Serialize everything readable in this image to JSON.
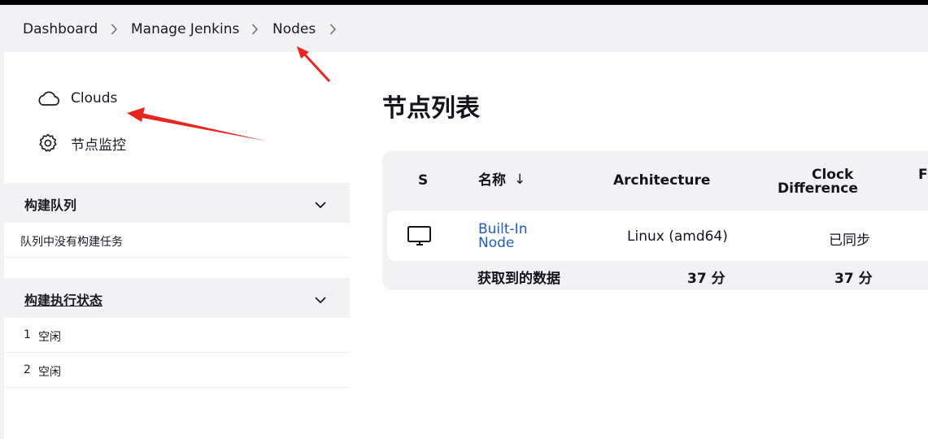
{
  "breadcrumb": {
    "items": [
      "Dashboard",
      "Manage Jenkins",
      "Nodes"
    ]
  },
  "sidebar": {
    "tasks": [
      {
        "label": "Clouds",
        "icon": "cloud-icon"
      },
      {
        "label": "节点监控",
        "icon": "gear-icon"
      }
    ],
    "build_queue": {
      "title": "构建队列",
      "empty_text": "队列中没有构建任务"
    },
    "executor_status": {
      "title": "构建执行状态",
      "executors": [
        {
          "number": "1",
          "state": "空闲"
        },
        {
          "number": "2",
          "state": "空闲"
        }
      ]
    }
  },
  "main": {
    "title": "节点列表",
    "table": {
      "headers": {
        "status": "S",
        "name": "名称",
        "sort_arrow": "↓",
        "architecture": "Architecture",
        "clock_line1": "Clock",
        "clock_line2": "Difference",
        "next_cut": "Fr"
      },
      "rows": [
        {
          "icon": "computer-icon",
          "name_line1": "Built-In",
          "name_line2": "Node",
          "architecture": "Linux (amd64)",
          "clock": "已同步"
        }
      ],
      "footer": {
        "label": "获取到的数据",
        "architecture_age": "37 分",
        "clock_age": "37 分"
      }
    }
  },
  "colors": {
    "link": "#1c5fc0",
    "annotation_arrow": "#e8251e",
    "pane_bg": "#f2f2f4"
  }
}
